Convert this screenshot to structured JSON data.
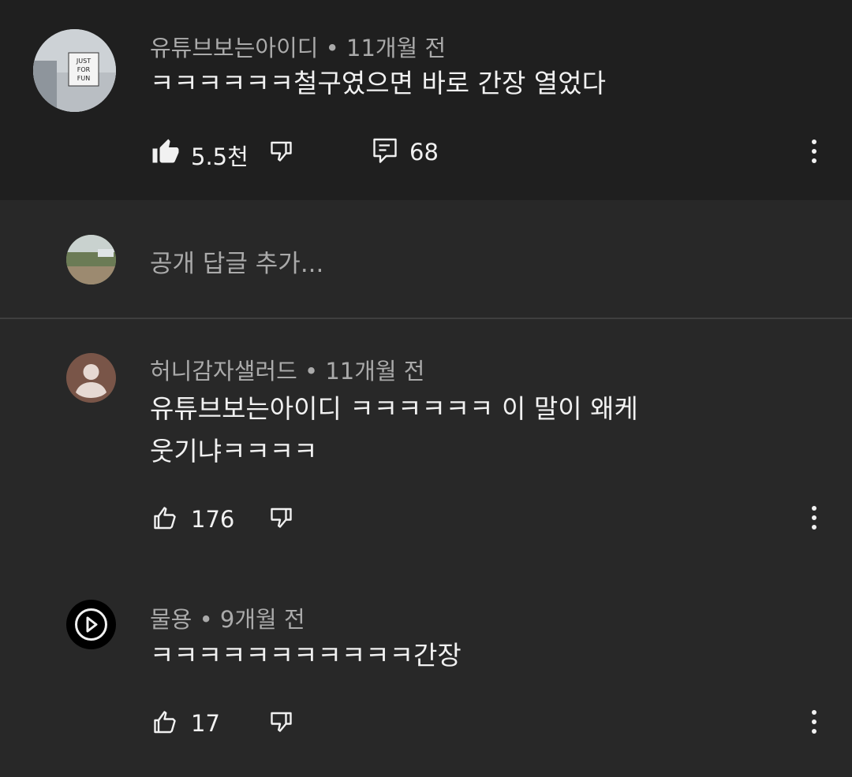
{
  "main_comment": {
    "author": "유튜브보는아이디",
    "time": "11개월 전",
    "text": "ㅋㅋㅋㅋㅋㅋ철구였으면 바로 간장 열었다",
    "likes": "5.5천",
    "replies": "68",
    "avatar_sign_lines": [
      "JUST",
      "FOR",
      "FUN"
    ]
  },
  "reply_box": {
    "placeholder": "공개 답글 추가..."
  },
  "replies": [
    {
      "author": "허니감자샐러드",
      "time": "11개월 전",
      "text_lines": [
        "유튜브보는아이디 ㅋㅋㅋㅋㅋㅋ 이 말이 왜케",
        "웃기냐ㅋㅋㅋㅋ"
      ],
      "likes": "176"
    },
    {
      "author": "물용",
      "time": "9개월 전",
      "text_lines": [
        "ㅋㅋㅋㅋㅋㅋㅋㅋㅋㅋㅋ간장"
      ],
      "likes": "17"
    }
  ],
  "separator": "•",
  "icons": [
    "thumbs-up-filled-icon",
    "thumbs-down-icon",
    "reply-icon",
    "more-vert-icon",
    "thumbs-up-icon",
    "default-avatar-icon",
    "play-circle-icon"
  ],
  "colors": {
    "top_bg": "#1f1f1f",
    "page_bg": "#282828",
    "text": "#f1f1f1",
    "secondary_text": "#aaaaaa"
  }
}
